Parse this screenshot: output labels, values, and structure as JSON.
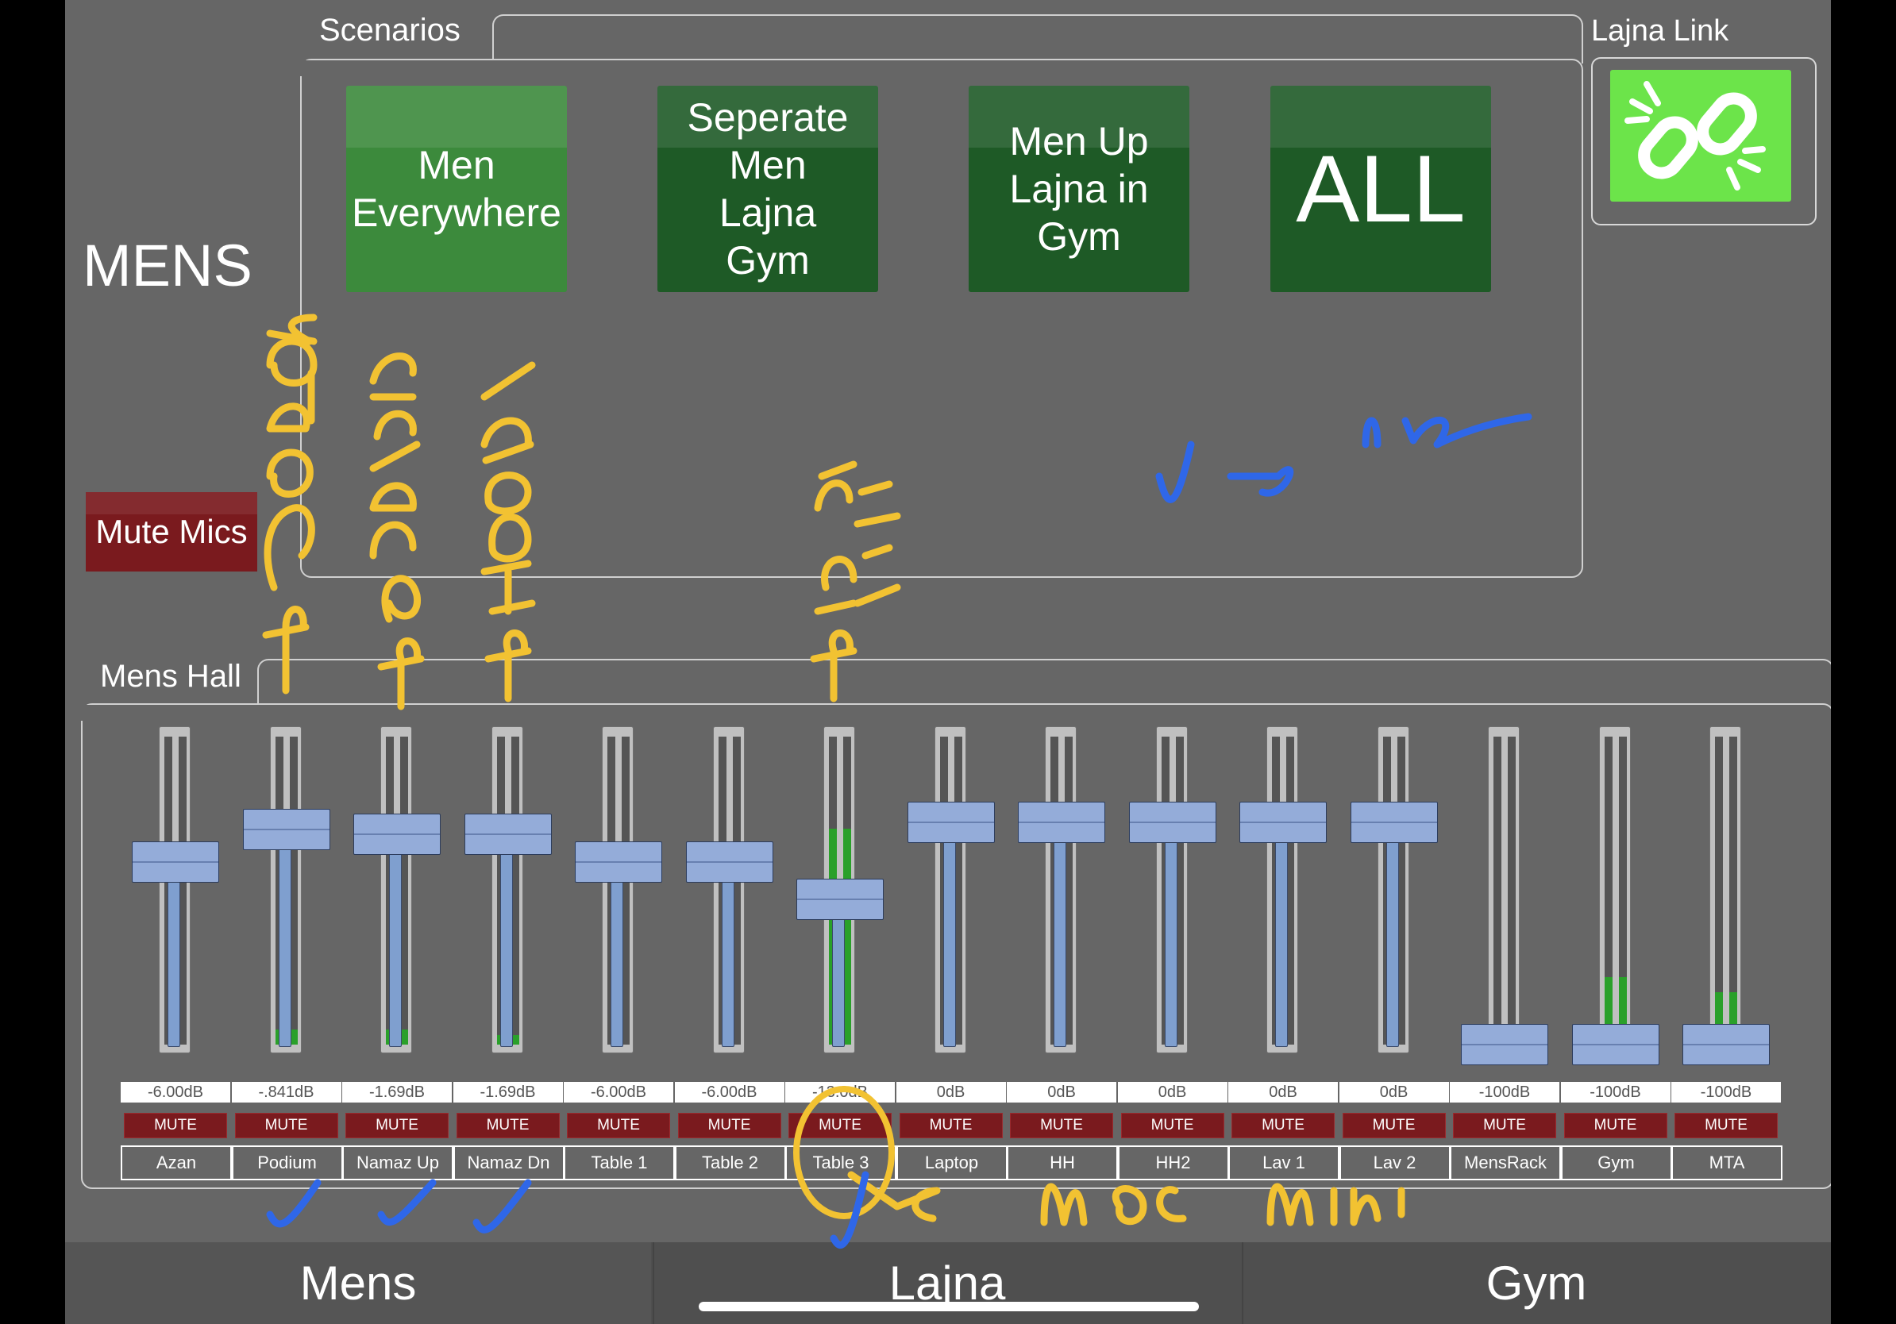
{
  "page": {
    "title": "MENS",
    "mute_mics_label": "Mute Mics"
  },
  "scenarios": {
    "label": "Scenarios",
    "buttons": [
      {
        "label": "Men\nEverywhere",
        "active": true
      },
      {
        "label": "Seperate\nMen\nLajna\nGym",
        "active": false
      },
      {
        "label": "Men Up\nLajna in\nGym",
        "active": false
      },
      {
        "label": "ALL",
        "active": false
      }
    ]
  },
  "lajna_link": {
    "label": "Lajna Link",
    "icon": "broken-link-icon",
    "color": "#6ce44a"
  },
  "mens_hall": {
    "label": "Mens Hall",
    "mute_label": "MUTE",
    "channels": [
      {
        "name": "Azan",
        "db": "-6.00dB",
        "level": 0.78,
        "meter": 0
      },
      {
        "name": "Podium",
        "db": "-.841dB",
        "level": 0.92,
        "meter": 0.05
      },
      {
        "name": "Namaz Up",
        "db": "-1.69dB",
        "level": 0.9,
        "meter": 0.05
      },
      {
        "name": "Namaz Dn",
        "db": "-1.69dB",
        "level": 0.9,
        "meter": 0.03
      },
      {
        "name": "Table 1",
        "db": "-6.00dB",
        "level": 0.78,
        "meter": 0
      },
      {
        "name": "Table 2",
        "db": "-6.00dB",
        "level": 0.78,
        "meter": 0
      },
      {
        "name": "Table 3",
        "db": "-13.0dB",
        "level": 0.62,
        "meter": 0.7
      },
      {
        "name": "Laptop",
        "db": "0dB",
        "level": 0.95,
        "meter": 0
      },
      {
        "name": "HH",
        "db": "0dB",
        "level": 0.95,
        "meter": 0
      },
      {
        "name": "HH2",
        "db": "0dB",
        "level": 0.95,
        "meter": 0
      },
      {
        "name": "Lav 1",
        "db": "0dB",
        "level": 0.95,
        "meter": 0
      },
      {
        "name": "Lav 2",
        "db": "0dB",
        "level": 0.95,
        "meter": 0
      },
      {
        "name": "MensRack",
        "db": "-100dB",
        "level": 0.0,
        "meter": 0
      },
      {
        "name": "Gym",
        "db": "-100dB",
        "level": 0.0,
        "meter": 0.22
      },
      {
        "name": "MTA",
        "db": "-100dB",
        "level": 0.0,
        "meter": 0.17
      }
    ]
  },
  "tabs": [
    {
      "label": "Mens",
      "active": true
    },
    {
      "label": "Lajna",
      "active": false
    },
    {
      "label": "Gym",
      "active": false
    }
  ],
  "colors": {
    "panel": "#666666",
    "scenario_active": "#3c8a3c",
    "scenario_idle": "#1e5a26",
    "mute": "#7a1a1e",
    "meter": "#2aa02a",
    "fader": "#94acd9"
  }
}
